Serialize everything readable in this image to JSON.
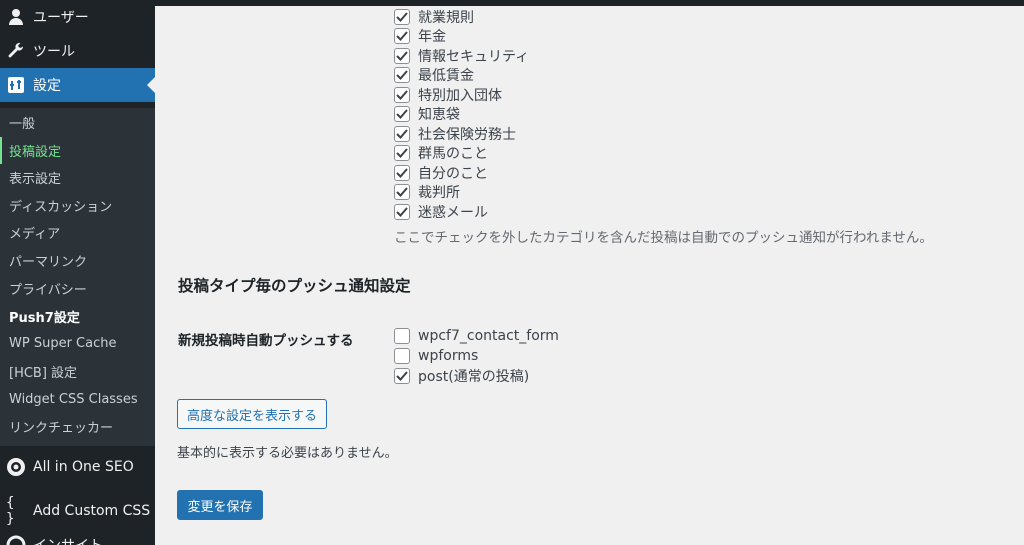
{
  "sidebar": {
    "menu": [
      {
        "label": "ユーザー",
        "icon": "user-icon"
      },
      {
        "label": "ツール",
        "icon": "wrench-icon"
      },
      {
        "label": "設定",
        "icon": "settings-icon"
      }
    ],
    "submenu": [
      {
        "label": "一般"
      },
      {
        "label": "投稿設定"
      },
      {
        "label": "表示設定"
      },
      {
        "label": "ディスカッション"
      },
      {
        "label": "メディア"
      },
      {
        "label": "パーマリンク"
      },
      {
        "label": "プライバシー"
      },
      {
        "label": "Push7設定"
      },
      {
        "label": "WP Super Cache"
      },
      {
        "label": "[HCB] 設定"
      },
      {
        "label": "Widget CSS Classes"
      },
      {
        "label": "リンクチェッカー"
      }
    ],
    "bottom_menu": [
      {
        "label": "All in One SEO",
        "icon": "aioseo-icon"
      },
      {
        "label": "Add Custom CSS",
        "icon": "braces-icon"
      },
      {
        "label": "インサイト",
        "icon": "insights-icon"
      }
    ]
  },
  "categories": [
    {
      "label": "就業規則",
      "checked": true
    },
    {
      "label": "年金",
      "checked": true
    },
    {
      "label": "情報セキュリティ",
      "checked": true
    },
    {
      "label": "最低賃金",
      "checked": true
    },
    {
      "label": "特別加入団体",
      "checked": true
    },
    {
      "label": "知恵袋",
      "checked": true
    },
    {
      "label": "社会保険労務士",
      "checked": true
    },
    {
      "label": "群馬のこと",
      "checked": true
    },
    {
      "label": "自分のこと",
      "checked": true
    },
    {
      "label": "裁判所",
      "checked": true
    },
    {
      "label": "迷惑メール",
      "checked": true
    }
  ],
  "categories_description": "ここでチェックを外したカテゴリを含んだ投稿は自動でのプッシュ通知が行われません。",
  "post_type_section": {
    "title": "投稿タイプ毎のプッシュ通知設定",
    "field_label": "新規投稿時自動プッシュする",
    "options": [
      {
        "label": "wpcf7_contact_form",
        "checked": false
      },
      {
        "label": "wpforms",
        "checked": false
      },
      {
        "label": "post(通常の投稿)",
        "checked": true
      }
    ]
  },
  "advanced_button": "高度な設定を表示する",
  "advanced_note": "基本的に表示する必要はありません。",
  "save_button": "変更を保存",
  "colors": {
    "sidebar_bg": "#1d2327",
    "submenu_bg": "#2c3338",
    "accent": "#2271b1",
    "current_item": "#72e38f",
    "content_bg": "#f0f0f1"
  }
}
